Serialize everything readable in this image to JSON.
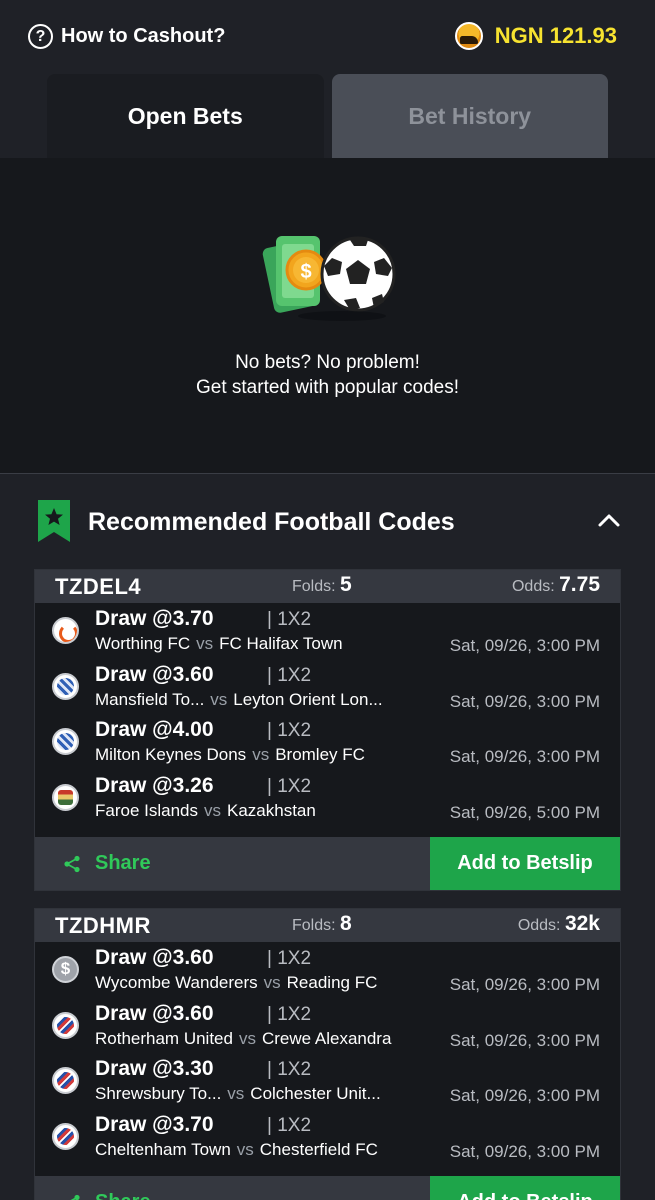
{
  "topbar": {
    "howto_label": "How to Cashout?",
    "balance": "NGN 121.93"
  },
  "tabs": [
    {
      "label": "Open Bets",
      "active": true
    },
    {
      "label": "Bet History",
      "active": false
    }
  ],
  "empty_state": {
    "line1": "No bets? No problem!",
    "line2": "Get started with popular codes!"
  },
  "recommended": {
    "title": "Recommended Football Codes"
  },
  "cards": [
    {
      "code": "TZDEL4",
      "folds_label": "Folds:",
      "folds": "5",
      "odds_label": "Odds:",
      "odds": "7.75",
      "share_label": "Share",
      "add_label": "Add to Betslip",
      "bets": [
        {
          "pick": "Draw @3.70",
          "market": "| 1X2",
          "home": "Worthing FC",
          "vs": "vs",
          "away": "FC Halifax Town",
          "time": "Sat, 09/26, 3:00 PM",
          "logo": "orange"
        },
        {
          "pick": "Draw @3.60",
          "market": "| 1X2",
          "home": "Mansfield To...",
          "vs": "vs",
          "away": "Leyton Orient Lon...",
          "time": "Sat, 09/26, 3:00 PM",
          "logo": "blue"
        },
        {
          "pick": "Draw @4.00",
          "market": "| 1X2",
          "home": "Milton Keynes Dons",
          "vs": "vs",
          "away": "Bromley FC",
          "time": "Sat, 09/26, 3:00 PM",
          "logo": "blue"
        },
        {
          "pick": "Draw @3.26",
          "market": "| 1X2",
          "home": "Faroe Islands",
          "vs": "vs",
          "away": "Kazakhstan",
          "time": "Sat, 09/26, 5:00 PM",
          "logo": "flag"
        }
      ]
    },
    {
      "code": "TZDHMR",
      "folds_label": "Folds:",
      "folds": "8",
      "odds_label": "Odds:",
      "odds": "32k",
      "share_label": "Share",
      "add_label": "Add to Betslip",
      "bets": [
        {
          "pick": "Draw @3.60",
          "market": "| 1X2",
          "home": "Wycombe Wanderers",
          "vs": "vs",
          "away": "Reading FC",
          "time": "Sat, 09/26, 3:00 PM",
          "logo": "gray"
        },
        {
          "pick": "Draw @3.60",
          "market": "| 1X2",
          "home": "Rotherham United",
          "vs": "vs",
          "away": "Crewe Alexandra",
          "time": "Sat, 09/26, 3:00 PM",
          "logo": "red"
        },
        {
          "pick": "Draw @3.30",
          "market": "| 1X2",
          "home": "Shrewsbury To...",
          "vs": "vs",
          "away": "Colchester Unit...",
          "time": "Sat, 09/26, 3:00 PM",
          "logo": "red"
        },
        {
          "pick": "Draw @3.70",
          "market": "| 1X2",
          "home": "Cheltenham Town",
          "vs": "vs",
          "away": "Chesterfield FC",
          "time": "Sat, 09/26, 3:00 PM",
          "logo": "red"
        }
      ]
    }
  ],
  "colors": {
    "accent_green": "#1ea54a",
    "balance_yellow": "#f7e330",
    "background": "#1f2127"
  },
  "icons": [
    "question-circle-icon",
    "coin-icon",
    "cash-ball-illustration",
    "star-bookmark-icon",
    "chevron-up-icon",
    "share-icon"
  ]
}
